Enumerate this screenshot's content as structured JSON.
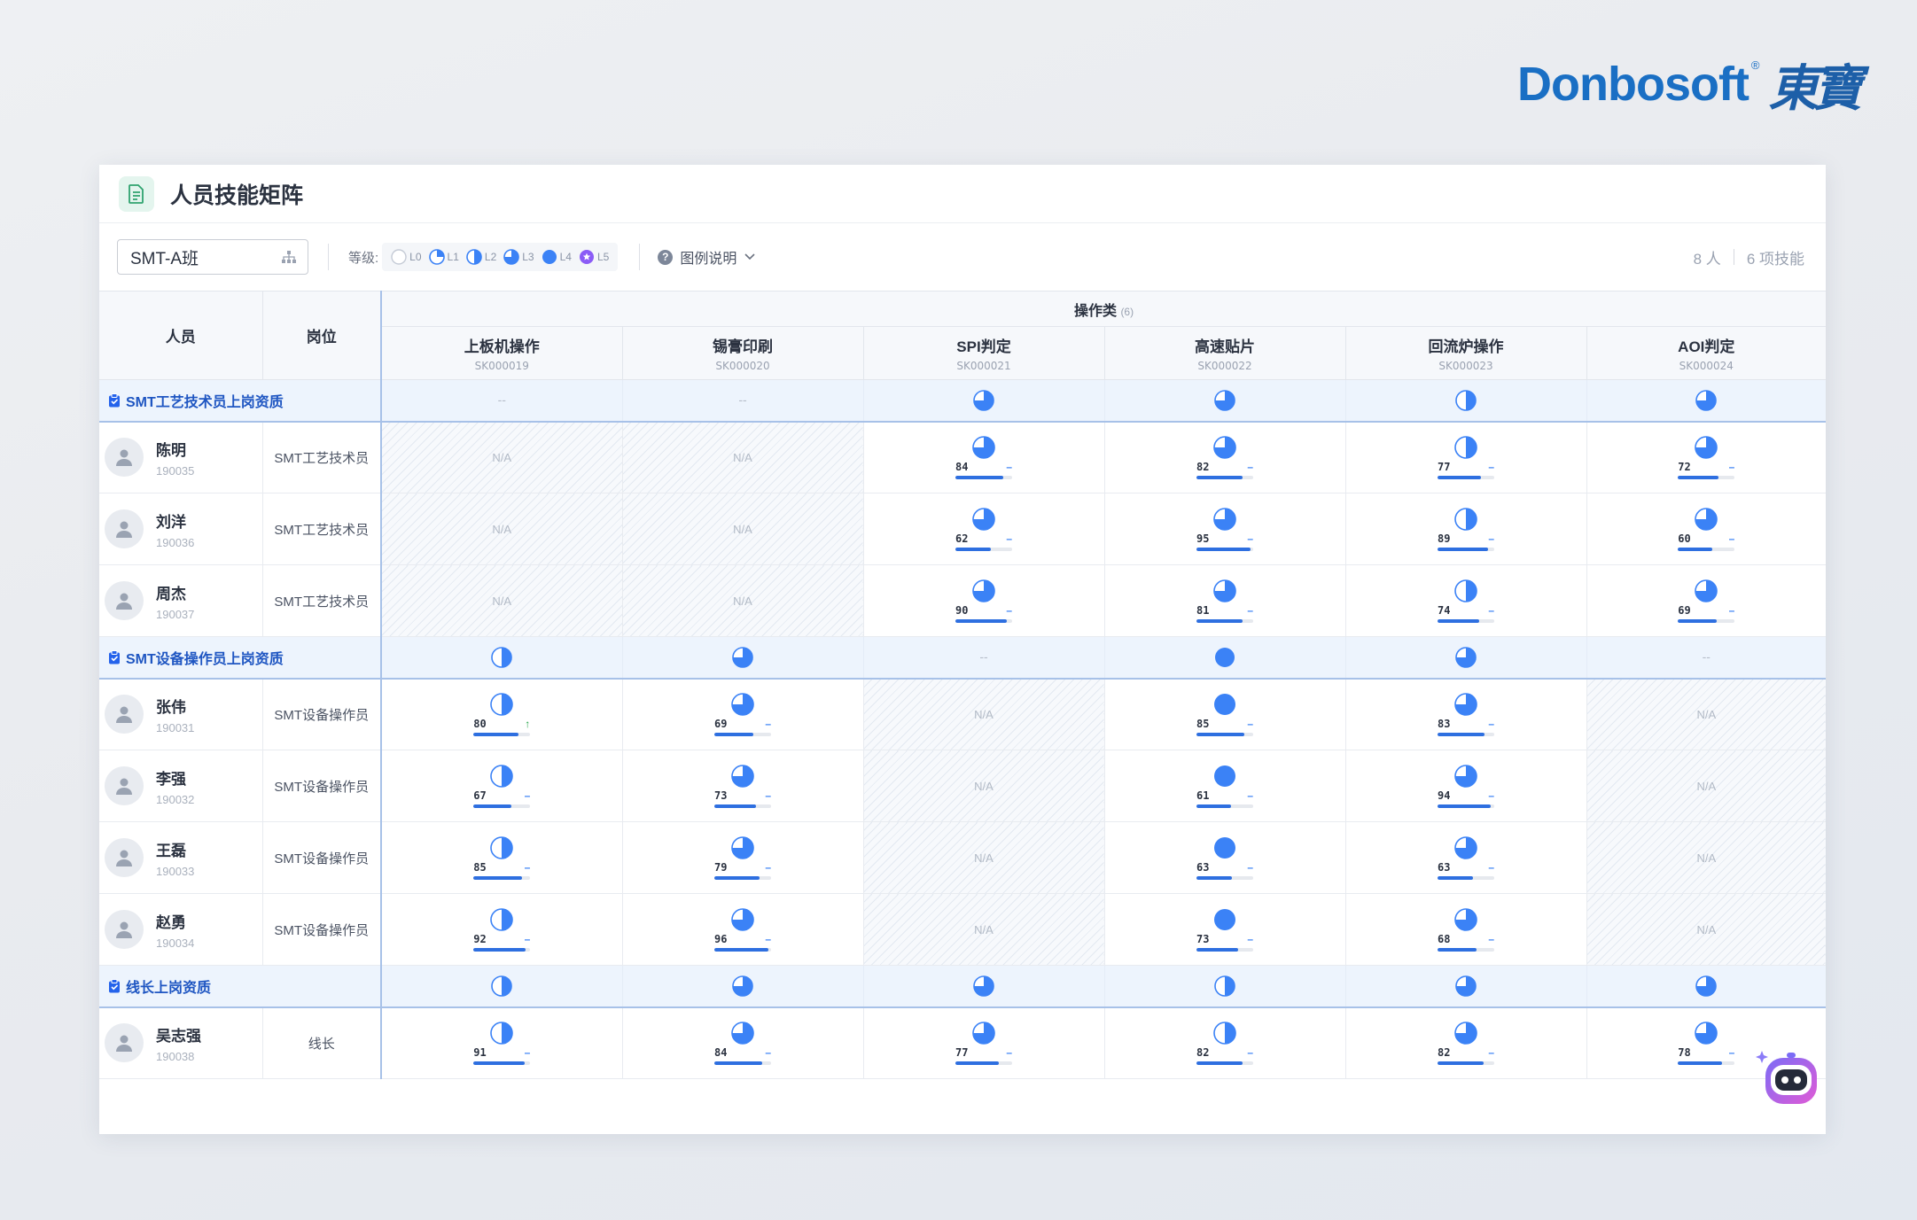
{
  "brand": {
    "name": "Donbosoft",
    "registered": "®",
    "chinese": "東寶"
  },
  "page": {
    "title": "人员技能矩阵"
  },
  "toolbar": {
    "team": "SMT-A班",
    "level_label": "等级:",
    "levels": [
      "L0",
      "L1",
      "L2",
      "L3",
      "L4",
      "L5"
    ],
    "legend_help": "图例说明",
    "people_count": "8 人",
    "skill_count": "6 项技能"
  },
  "table": {
    "col_person": "人员",
    "col_post": "岗位",
    "group_name": "操作类",
    "group_count": "(6)",
    "na_text": "N/A",
    "dash_text": "--",
    "skills": [
      {
        "name": "上板机操作",
        "code": "SK000019"
      },
      {
        "name": "锡膏印刷",
        "code": "SK000020"
      },
      {
        "name": "SPI判定",
        "code": "SK000021"
      },
      {
        "name": "高速贴片",
        "code": "SK000022"
      },
      {
        "name": "回流炉操作",
        "code": "SK000023"
      },
      {
        "name": "AOI判定",
        "code": "SK000024"
      }
    ]
  },
  "groups": [
    {
      "name": "SMT工艺技术员上岗资质",
      "requirements": [
        null,
        null,
        3,
        3,
        2,
        3
      ],
      "people": [
        {
          "name": "陈明",
          "id": "190035",
          "post": "SMT工艺技术员",
          "cells": [
            null,
            null,
            {
              "level": 3,
              "score": "84",
              "trend": "–",
              "pct": 84
            },
            {
              "level": 3,
              "score": "82",
              "trend": "–",
              "pct": 82
            },
            {
              "level": 2,
              "score": "77",
              "trend": "–",
              "pct": 77
            },
            {
              "level": 3,
              "score": "72",
              "trend": "–",
              "pct": 72
            }
          ]
        },
        {
          "name": "刘洋",
          "id": "190036",
          "post": "SMT工艺技术员",
          "cells": [
            null,
            null,
            {
              "level": 3,
              "score": "62",
              "trend": "–",
              "pct": 62
            },
            {
              "level": 3,
              "score": "95",
              "trend": "–",
              "pct": 95
            },
            {
              "level": 2,
              "score": "89",
              "trend": "–",
              "pct": 89
            },
            {
              "level": 3,
              "score": "60",
              "trend": "–",
              "pct": 60
            }
          ]
        },
        {
          "name": "周杰",
          "id": "190037",
          "post": "SMT工艺技术员",
          "cells": [
            null,
            null,
            {
              "level": 3,
              "score": "90",
              "trend": "–",
              "pct": 90
            },
            {
              "level": 3,
              "score": "81",
              "trend": "–",
              "pct": 81
            },
            {
              "level": 2,
              "score": "74",
              "trend": "–",
              "pct": 74
            },
            {
              "level": 3,
              "score": "69",
              "trend": "–",
              "pct": 69
            }
          ]
        }
      ]
    },
    {
      "name": "SMT设备操作员上岗资质",
      "requirements": [
        2,
        3,
        null,
        4,
        3,
        null
      ],
      "people": [
        {
          "name": "张伟",
          "id": "190031",
          "post": "SMT设备操作员",
          "cells": [
            {
              "level": 2,
              "score": "80",
              "trend": "↑",
              "up": true,
              "pct": 80
            },
            {
              "level": 3,
              "score": "69",
              "trend": "–",
              "pct": 69
            },
            null,
            {
              "level": 4,
              "score": "85",
              "trend": "–",
              "pct": 85
            },
            {
              "level": 3,
              "score": "83",
              "trend": "–",
              "pct": 83
            },
            null
          ]
        },
        {
          "name": "李强",
          "id": "190032",
          "post": "SMT设备操作员",
          "cells": [
            {
              "level": 2,
              "score": "67",
              "trend": "–",
              "pct": 67
            },
            {
              "level": 3,
              "score": "73",
              "trend": "–",
              "pct": 73
            },
            null,
            {
              "level": 4,
              "score": "61",
              "trend": "–",
              "pct": 61
            },
            {
              "level": 3,
              "score": "94",
              "trend": "–",
              "pct": 94
            },
            null
          ]
        },
        {
          "name": "王磊",
          "id": "190033",
          "post": "SMT设备操作员",
          "cells": [
            {
              "level": 2,
              "score": "85",
              "trend": "–",
              "pct": 85
            },
            {
              "level": 3,
              "score": "79",
              "trend": "–",
              "pct": 79
            },
            null,
            {
              "level": 4,
              "score": "63",
              "trend": "–",
              "pct": 63
            },
            {
              "level": 3,
              "score": "63",
              "trend": "–",
              "pct": 63
            },
            null
          ]
        },
        {
          "name": "赵勇",
          "id": "190034",
          "post": "SMT设备操作员",
          "cells": [
            {
              "level": 2,
              "score": "92",
              "trend": "–",
              "pct": 92
            },
            {
              "level": 3,
              "score": "96",
              "trend": "–",
              "pct": 96
            },
            null,
            {
              "level": 4,
              "score": "73",
              "trend": "–",
              "pct": 73
            },
            {
              "level": 3,
              "score": "68",
              "trend": "–",
              "pct": 68
            },
            null
          ]
        }
      ]
    },
    {
      "name": "线长上岗资质",
      "requirements": [
        2,
        3,
        3,
        2,
        3,
        3
      ],
      "people": [
        {
          "name": "吴志强",
          "id": "190038",
          "post": "线长",
          "cells": [
            {
              "level": 2,
              "score": "91",
              "trend": "–",
              "pct": 91
            },
            {
              "level": 3,
              "score": "84",
              "trend": "–",
              "pct": 84
            },
            {
              "level": 3,
              "score": "77",
              "trend": "–",
              "pct": 77
            },
            {
              "level": 2,
              "score": "82",
              "trend": "–",
              "pct": 82
            },
            {
              "level": 3,
              "score": "82",
              "trend": "–",
              "pct": 82
            },
            {
              "level": 3,
              "score": "78",
              "trend": "–",
              "pct": 78
            }
          ]
        }
      ]
    }
  ],
  "colors": {
    "accent": "#3b82f6",
    "group_text": "#1f56c2",
    "trend_up": "#22a447",
    "brand": "#1a6fc4"
  }
}
